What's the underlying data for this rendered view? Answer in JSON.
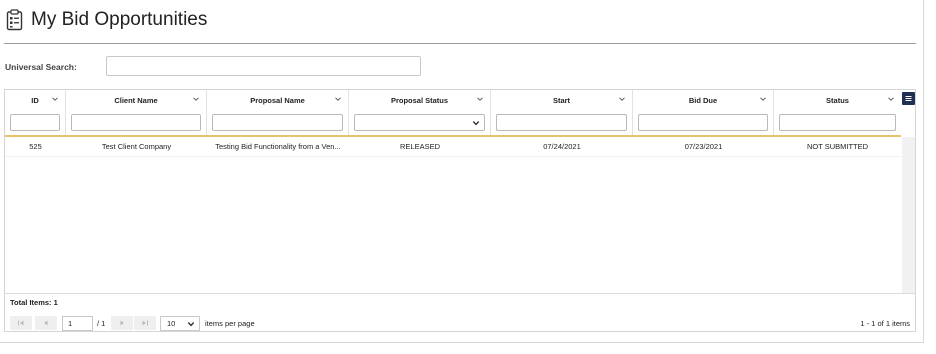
{
  "page": {
    "title": "My Bid Opportunities",
    "icon": "clipboard-list-icon"
  },
  "search": {
    "label": "Universal Search:",
    "value": "",
    "placeholder": ""
  },
  "grid": {
    "columns": [
      {
        "id": "id",
        "label": "ID",
        "filter_type": "text"
      },
      {
        "id": "client",
        "label": "Client Name",
        "filter_type": "text"
      },
      {
        "id": "proposal",
        "label": "Proposal Name",
        "filter_type": "text"
      },
      {
        "id": "pstatus",
        "label": "Proposal Status",
        "filter_type": "select"
      },
      {
        "id": "start",
        "label": "Start",
        "filter_type": "text"
      },
      {
        "id": "due",
        "label": "Bid Due",
        "filter_type": "text"
      },
      {
        "id": "status",
        "label": "Status",
        "filter_type": "text"
      }
    ],
    "rows": [
      {
        "id": "525",
        "client": "Test Client Company",
        "proposal": "Testing Bid Functionality from a Ven...",
        "pstatus": "RELEASED",
        "start": "07/24/2021",
        "due": "07/23/2021",
        "status": "NOT SUBMITTED"
      }
    ]
  },
  "footer": {
    "total_items": "Total Items: 1",
    "current_page": "1",
    "page_of": "/ 1",
    "page_size": "10",
    "items_per_page": "items per page",
    "range": "1 - 1 of 1 items"
  },
  "colors": {
    "accent_underline": "#e9c26a",
    "menu_button": "#1f3152",
    "divider": "#9a9a9a"
  }
}
